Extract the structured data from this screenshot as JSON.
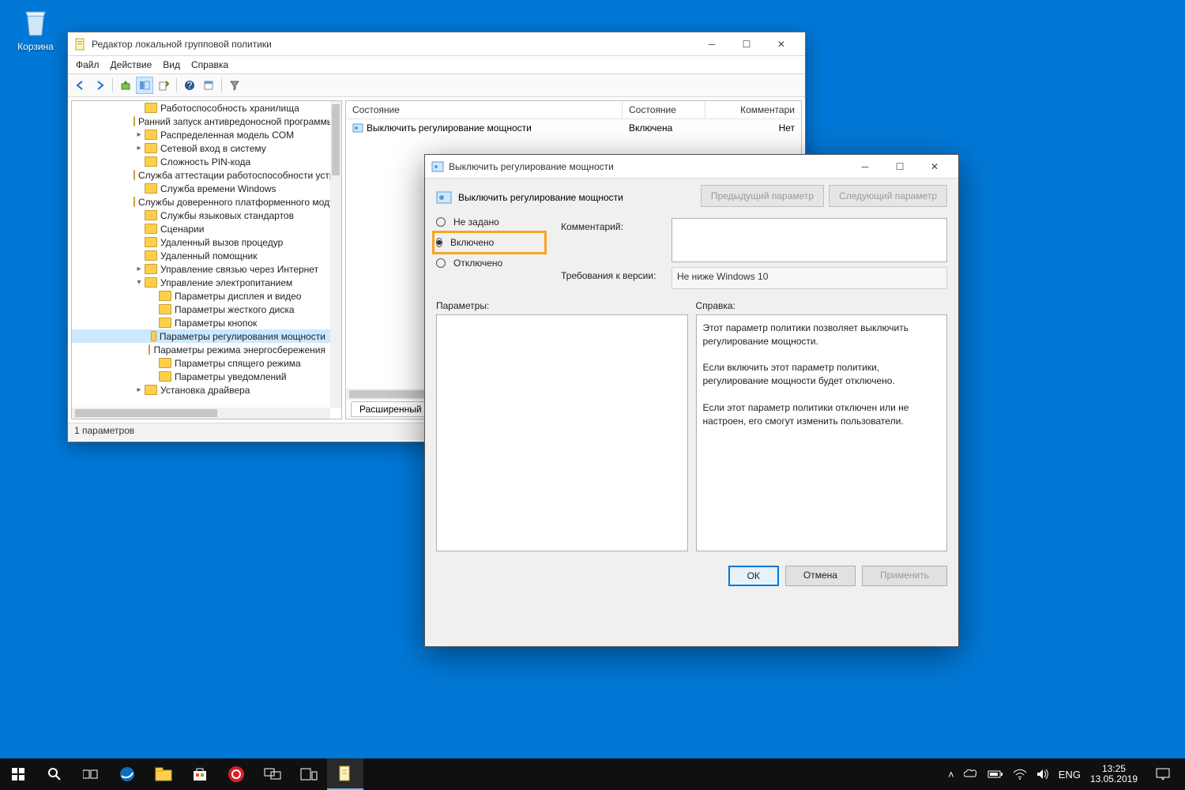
{
  "desktop": {
    "recycle_bin": "Корзина"
  },
  "gpedit": {
    "title": "Редактор локальной групповой политики",
    "menu": {
      "file": "Файл",
      "action": "Действие",
      "view": "Вид",
      "help": "Справка"
    },
    "tree": [
      {
        "indent": 1,
        "exp": "",
        "label": "Работоспособность хранилища"
      },
      {
        "indent": 1,
        "exp": "",
        "label": "Ранний запуск антивредоносной программы"
      },
      {
        "indent": 1,
        "exp": ">",
        "label": "Распределенная модель COM"
      },
      {
        "indent": 1,
        "exp": ">",
        "label": "Сетевой вход в систему"
      },
      {
        "indent": 1,
        "exp": "",
        "label": "Сложность PIN-кода"
      },
      {
        "indent": 1,
        "exp": "",
        "label": "Служба аттестации работоспособности устр"
      },
      {
        "indent": 1,
        "exp": "",
        "label": "Служба времени Windows"
      },
      {
        "indent": 1,
        "exp": "",
        "label": "Службы доверенного платформенного моду"
      },
      {
        "indent": 1,
        "exp": "",
        "label": "Службы языковых стандартов"
      },
      {
        "indent": 1,
        "exp": "",
        "label": "Сценарии"
      },
      {
        "indent": 1,
        "exp": "",
        "label": "Удаленный вызов процедур"
      },
      {
        "indent": 1,
        "exp": "",
        "label": "Удаленный помощник"
      },
      {
        "indent": 1,
        "exp": ">",
        "label": "Управление связью через Интернет"
      },
      {
        "indent": 1,
        "exp": "v",
        "label": "Управление электропитанием"
      },
      {
        "indent": 2,
        "exp": "",
        "label": "Параметры дисплея и видео"
      },
      {
        "indent": 2,
        "exp": "",
        "label": "Параметры жесткого диска"
      },
      {
        "indent": 2,
        "exp": "",
        "label": "Параметры кнопок"
      },
      {
        "indent": 2,
        "exp": "",
        "label": "Параметры регулирования мощности",
        "sel": true
      },
      {
        "indent": 2,
        "exp": "",
        "label": "Параметры режима энергосбережения"
      },
      {
        "indent": 2,
        "exp": "",
        "label": "Параметры спящего режима"
      },
      {
        "indent": 2,
        "exp": "",
        "label": "Параметры уведомлений"
      },
      {
        "indent": 1,
        "exp": ">",
        "label": "Установка драйвера"
      }
    ],
    "list": {
      "cols": {
        "state_hdr": "Состояние",
        "state_col": "Состояние",
        "comment_col": "Комментари"
      },
      "row": {
        "name": "Выключить регулирование мощности",
        "state": "Включена",
        "comment": "Нет"
      }
    },
    "tab": "Расширенный",
    "status": "1 параметров"
  },
  "dialog": {
    "title": "Выключить регулирование мощности",
    "heading": "Выключить регулирование мощности",
    "nav": {
      "prev": "Предыдущий параметр",
      "next": "Следующий параметр"
    },
    "radios": {
      "notconf": "Не задано",
      "enabled": "Включено",
      "disabled": "Отключено"
    },
    "comment_label": "Комментарий:",
    "req_label": "Требования к версии:",
    "req_value": "Не ниже Windows 10",
    "params_label": "Параметры:",
    "help_label": "Справка:",
    "help_p1": "Этот параметр политики позволяет выключить регулирование мощности.",
    "help_p2": "Если включить этот параметр политики, регулирование мощности будет отключено.",
    "help_p3": "Если этот параметр политики отключен или не настроен, его смогут изменить пользователи.",
    "buttons": {
      "ok": "ОК",
      "cancel": "Отмена",
      "apply": "Применить"
    }
  },
  "taskbar": {
    "lang": "ENG",
    "time": "13:25",
    "date": "13.05.2019"
  }
}
